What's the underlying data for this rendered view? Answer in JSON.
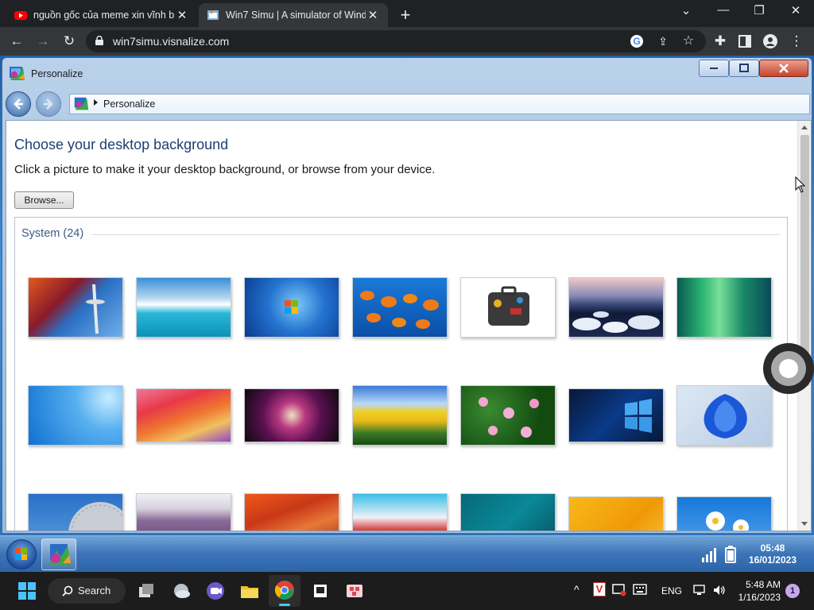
{
  "browser": {
    "tabs": [
      {
        "title": "nguồn gốc của meme xin vĩnh bi",
        "icon": "youtube-icon",
        "active": false
      },
      {
        "title": "Win7 Simu | A simulator of Wind",
        "icon": "win7-window-icon",
        "active": true
      }
    ],
    "url": "win7simu.visnalize.com"
  },
  "window": {
    "title": "Personalize",
    "breadcrumb": "Personalize"
  },
  "page": {
    "heading": "Choose your desktop background",
    "subtext": "Click a picture to make it your desktop background, or browse from your device.",
    "browse_label": "Browse...",
    "group_label": "System (24)"
  },
  "wallpapers": [
    "space-needle",
    "tropical-island",
    "windows7-default",
    "orange-fish",
    "suitcase",
    "snowy-lake",
    "aurora",
    "win7-blue",
    "macos-bigsur",
    "purple-dahlia",
    "yellow-tulips",
    "water-lilies",
    "windows10",
    "windows11-bloom",
    "atomium-sphere",
    "lavender-field",
    "desert-canyon",
    "colorful-village",
    "teal-abstract",
    "yellow-abstract",
    "white-daisies"
  ],
  "win7_taskbar": {
    "time": "05:48",
    "date": "16/01/2023"
  },
  "win11_taskbar": {
    "search_label": "Search",
    "language": "ENG",
    "time": "5:48 AM",
    "date": "1/16/2023",
    "notifications": "1"
  }
}
